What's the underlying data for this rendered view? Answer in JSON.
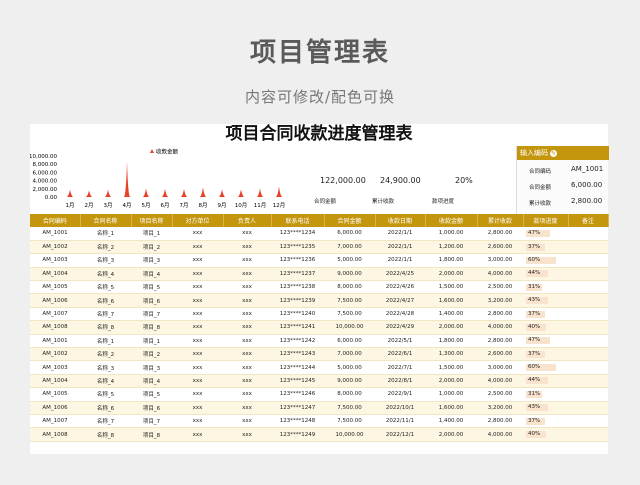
{
  "page": {
    "title": "项目管理表",
    "subtitle": "内容可修改/配色可换"
  },
  "sheet": {
    "title": "项目合同收款进度管理表"
  },
  "chart_data": {
    "type": "area",
    "legend": "收款金额",
    "legend_position": "top",
    "categories": [
      "1月",
      "2月",
      "3月",
      "4月",
      "5月",
      "6月",
      "7月",
      "8月",
      "9月",
      "10月",
      "11月",
      "12月"
    ],
    "values": [
      1800,
      1600,
      1800,
      8700,
      2100,
      2000,
      2000,
      2400,
      1900,
      1900,
      2100,
      2600
    ],
    "ylim": [
      0,
      10000
    ],
    "yticks": [
      "10,000.00",
      "8,000.00",
      "6,000.00",
      "4,000.00",
      "2,000.00",
      "0.00"
    ],
    "grid": false
  },
  "summary": {
    "contract_total": "122,000.00",
    "collected_total": "24,900.00",
    "progress": "20%",
    "contract_label": "合同金额",
    "collected_label": "累计收款",
    "progress_label": "款项进度"
  },
  "input": {
    "header": "输入编码",
    "icon": "pencil-icon",
    "code_label": "合同编码",
    "code_value": "AM_1001",
    "amount_label": "合同金额",
    "amount_value": "6,000.00",
    "collected_label": "累计收款",
    "collected_value": "2,800.00"
  },
  "table": {
    "headers": [
      "合同编码",
      "合同名称",
      "项目名称",
      "对方单位",
      "负责人",
      "联系电话",
      "合同金额",
      "收款日期",
      "收款金额",
      "累计收款",
      "款项进度",
      "备注"
    ],
    "rows": [
      [
        "AM_1001",
        "名称_1",
        "项目_1",
        "xxx",
        "xxx",
        "123****1234",
        "6,000.00",
        "2022/1/1",
        "1,000.00",
        "2,800.00",
        "47%",
        ""
      ],
      [
        "AM_1002",
        "名称_2",
        "项目_2",
        "xxx",
        "xxx",
        "123****1235",
        "7,000.00",
        "2022/1/1",
        "1,200.00",
        "2,600.00",
        "37%",
        ""
      ],
      [
        "AM_1003",
        "名称_3",
        "项目_3",
        "xxx",
        "xxx",
        "123****1236",
        "5,000.00",
        "2022/1/1",
        "1,800.00",
        "3,000.00",
        "60%",
        ""
      ],
      [
        "AM_1004",
        "名称_4",
        "项目_4",
        "xxx",
        "xxx",
        "123****1237",
        "9,000.00",
        "2022/4/25",
        "2,000.00",
        "4,000.00",
        "44%",
        ""
      ],
      [
        "AM_1005",
        "名称_5",
        "项目_5",
        "xxx",
        "xxx",
        "123****1238",
        "8,000.00",
        "2022/4/26",
        "1,500.00",
        "2,500.00",
        "31%",
        ""
      ],
      [
        "AM_1006",
        "名称_6",
        "项目_6",
        "xxx",
        "xxx",
        "123****1239",
        "7,500.00",
        "2022/4/27",
        "1,600.00",
        "3,200.00",
        "43%",
        ""
      ],
      [
        "AM_1007",
        "名称_7",
        "项目_7",
        "xxx",
        "xxx",
        "123****1240",
        "7,500.00",
        "2022/4/28",
        "1,400.00",
        "2,800.00",
        "37%",
        ""
      ],
      [
        "AM_1008",
        "名称_8",
        "项目_8",
        "xxx",
        "xxx",
        "123****1241",
        "10,000.00",
        "2022/4/29",
        "2,000.00",
        "4,000.00",
        "40%",
        ""
      ],
      [
        "AM_1001",
        "名称_1",
        "项目_1",
        "xxx",
        "xxx",
        "123****1242",
        "6,000.00",
        "2022/5/1",
        "1,800.00",
        "2,800.00",
        "47%",
        ""
      ],
      [
        "AM_1002",
        "名称_2",
        "项目_2",
        "xxx",
        "xxx",
        "123****1243",
        "7,000.00",
        "2022/6/1",
        "1,300.00",
        "2,600.00",
        "37%",
        ""
      ],
      [
        "AM_1003",
        "名称_3",
        "项目_3",
        "xxx",
        "xxx",
        "123****1244",
        "5,000.00",
        "2022/7/1",
        "1,500.00",
        "3,000.00",
        "60%",
        ""
      ],
      [
        "AM_1004",
        "名称_4",
        "项目_4",
        "xxx",
        "xxx",
        "123****1245",
        "9,000.00",
        "2022/8/1",
        "2,000.00",
        "4,000.00",
        "44%",
        ""
      ],
      [
        "AM_1005",
        "名称_5",
        "项目_5",
        "xxx",
        "xxx",
        "123****1246",
        "8,000.00",
        "2022/9/1",
        "1,000.00",
        "2,500.00",
        "31%",
        ""
      ],
      [
        "AM_1006",
        "名称_6",
        "项目_6",
        "xxx",
        "xxx",
        "123****1247",
        "7,500.00",
        "2022/10/1",
        "1,600.00",
        "3,200.00",
        "43%",
        ""
      ],
      [
        "AM_1007",
        "名称_7",
        "项目_7",
        "xxx",
        "xxx",
        "123****1248",
        "7,500.00",
        "2022/11/1",
        "1,400.00",
        "2,800.00",
        "37%",
        ""
      ],
      [
        "AM_1008",
        "名称_8",
        "项目_8",
        "xxx",
        "xxx",
        "123****1249",
        "10,000.00",
        "2022/12/1",
        "2,000.00",
        "4,000.00",
        "40%",
        ""
      ]
    ]
  },
  "colors": {
    "header": "#c4960e",
    "row_alt": "#fdf6e3",
    "bar": "#fae3cc",
    "chart": "#e8412a"
  }
}
